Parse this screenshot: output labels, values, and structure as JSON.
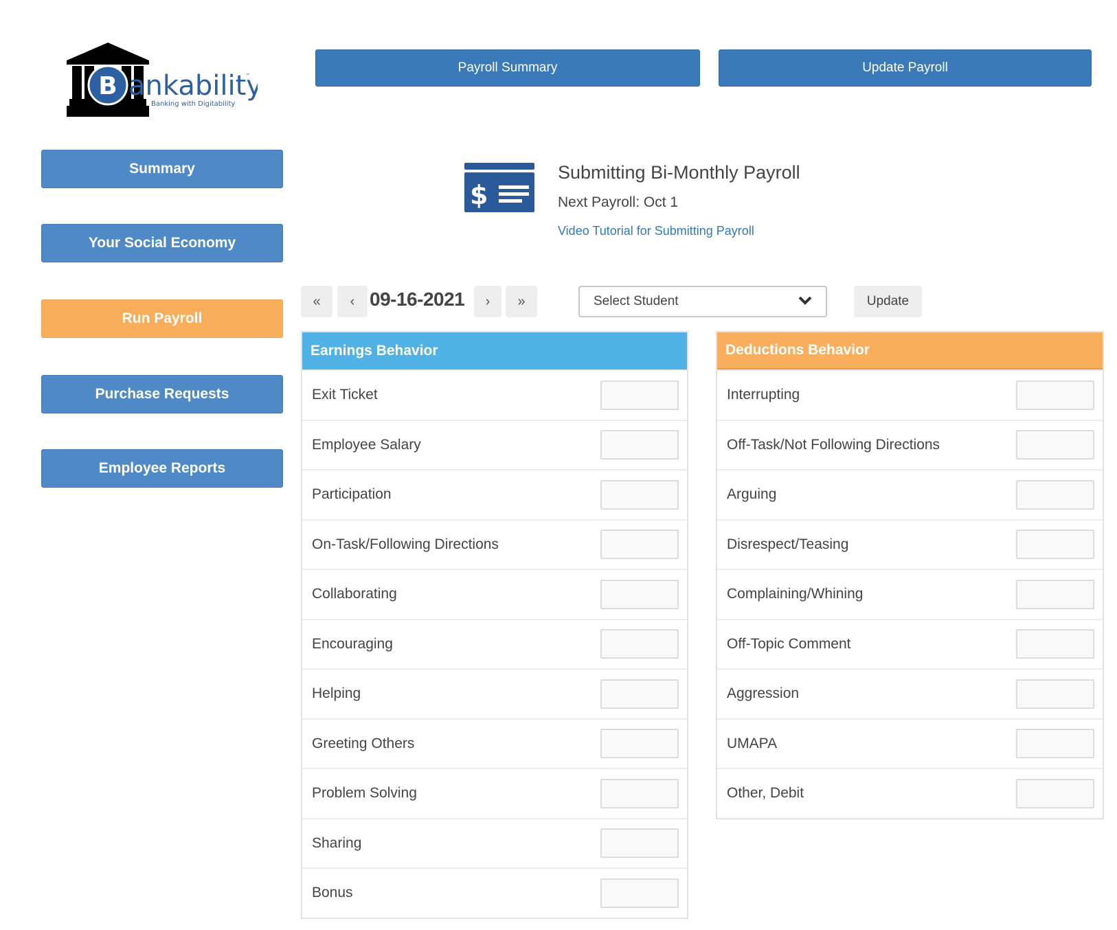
{
  "logo": {
    "brand_text": "ankability",
    "brand_letter": "B",
    "tagline": "Banking with Digitability",
    "trademark": "™"
  },
  "top_buttons": {
    "payroll_summary": "Payroll Summary",
    "update_payroll": "Update Payroll"
  },
  "sidebar": {
    "items": [
      {
        "label": "Summary",
        "active": false
      },
      {
        "label": "Your Social Economy",
        "active": false
      },
      {
        "label": "Run Payroll",
        "active": true
      },
      {
        "label": "Purchase Requests",
        "active": false
      },
      {
        "label": "Employee Reports",
        "active": false
      }
    ]
  },
  "payroll_info": {
    "icon": "payroll-check-icon",
    "title": "Submitting Bi-Monthly Payroll",
    "next_payroll": "Next Payroll: Oct 1",
    "tutorial_link": "Video Tutorial for Submitting Payroll"
  },
  "date_nav": {
    "first": "«",
    "prev": "‹",
    "date": "09-16-2021",
    "next": "›",
    "last": "»"
  },
  "student_select": {
    "selected": "Select Student",
    "chevron": "⌄"
  },
  "update_button": "Update",
  "earnings": {
    "title": "Earnings Behavior",
    "color": "#50b2e4",
    "rows": [
      {
        "label": "Exit Ticket",
        "value": ""
      },
      {
        "label": "Employee Salary",
        "value": ""
      },
      {
        "label": "Participation",
        "value": ""
      },
      {
        "label": "On-Task/Following Directions",
        "value": ""
      },
      {
        "label": "Collaborating",
        "value": ""
      },
      {
        "label": "Encouraging",
        "value": ""
      },
      {
        "label": "Helping",
        "value": ""
      },
      {
        "label": "Greeting Others",
        "value": ""
      },
      {
        "label": "Problem Solving",
        "value": ""
      },
      {
        "label": "Sharing",
        "value": ""
      },
      {
        "label": "Bonus",
        "value": ""
      }
    ]
  },
  "deductions": {
    "title": "Deductions Behavior",
    "color": "#f9ae5d",
    "rows": [
      {
        "label": "Interrupting",
        "value": ""
      },
      {
        "label": "Off-Task/Not Following Directions",
        "value": ""
      },
      {
        "label": "Arguing",
        "value": ""
      },
      {
        "label": "Disrespect/Teasing",
        "value": ""
      },
      {
        "label": "Complaining/Whining",
        "value": ""
      },
      {
        "label": "Off-Topic Comment",
        "value": ""
      },
      {
        "label": "Aggression",
        "value": ""
      },
      {
        "label": "UMAPA",
        "value": ""
      },
      {
        "label": "Other, Debit",
        "value": ""
      }
    ]
  }
}
